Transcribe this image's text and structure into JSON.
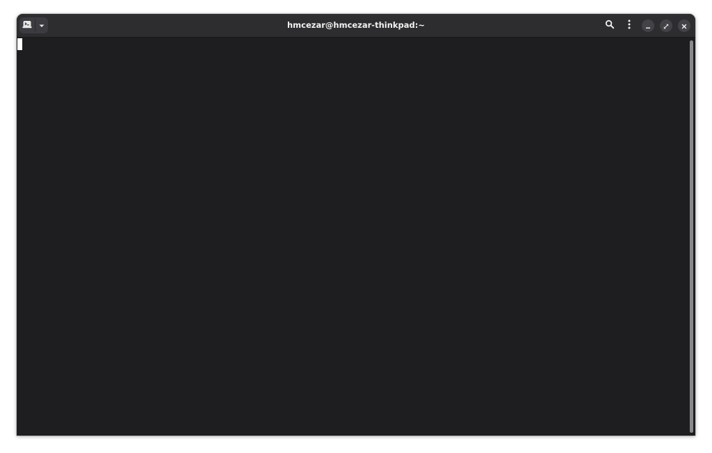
{
  "window": {
    "title": "hmcezar@hmcezar-thinkpad:~"
  },
  "header": {
    "new_tab_icon": "new-tab-icon",
    "dropdown_icon": "chevron-down-icon",
    "search_icon": "search-icon",
    "menu_icon": "vertical-dots-icon",
    "minimize_icon": "minimize-icon",
    "maximize_icon": "maximize-icon",
    "close_icon": "close-icon"
  },
  "colors": {
    "titlebar": "#2d2d30",
    "terminal_bg": "#1e1e20",
    "title_text": "#f2f2f2",
    "window_button_bg": "#434347",
    "cursor": "#ffffff",
    "scrollbar": "#8a8a8c"
  }
}
